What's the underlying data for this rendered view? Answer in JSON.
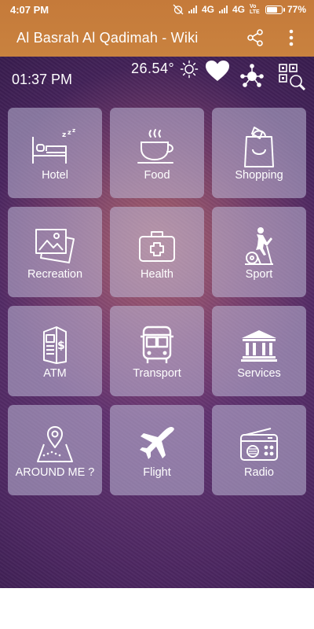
{
  "status_bar": {
    "time": "4:07 PM",
    "network_1": "4G",
    "network_2": "4G",
    "volte": "Vo LTE",
    "battery": "77%",
    "battery_level": 0.77
  },
  "toolbar": {
    "title": "Al Basrah Al Qadimah - Wiki",
    "share_icon": "share-icon",
    "menu_icon": "more-vert-icon"
  },
  "weather": {
    "clock": "01:37 PM",
    "temperature": "26.54°",
    "weather_icon": "sun-icon",
    "favorite_icon": "heart-icon",
    "network_icon": "network-icon",
    "qr_icon": "qr-search-icon"
  },
  "tiles": [
    {
      "label": "Hotel",
      "icon": "hotel-bed-icon"
    },
    {
      "label": "Food",
      "icon": "coffee-cup-icon"
    },
    {
      "label": "Shopping",
      "icon": "shopping-bag-icon"
    },
    {
      "label": "Recreation",
      "icon": "pictures-icon"
    },
    {
      "label": "Health",
      "icon": "first-aid-kit-icon"
    },
    {
      "label": "Sport",
      "icon": "exercise-bike-icon"
    },
    {
      "label": "ATM",
      "icon": "atm-icon"
    },
    {
      "label": "Transport",
      "icon": "bus-icon"
    },
    {
      "label": "Services",
      "icon": "bank-building-icon"
    },
    {
      "label": "AROUND ME ?",
      "icon": "map-pin-icon"
    },
    {
      "label": "Flight",
      "icon": "airplane-icon"
    },
    {
      "label": "Radio",
      "icon": "radio-icon"
    }
  ],
  "colors": {
    "toolbar": "#c57a3a",
    "tile_bg": "rgba(190,185,215,.55)",
    "text": "#ffffff"
  }
}
